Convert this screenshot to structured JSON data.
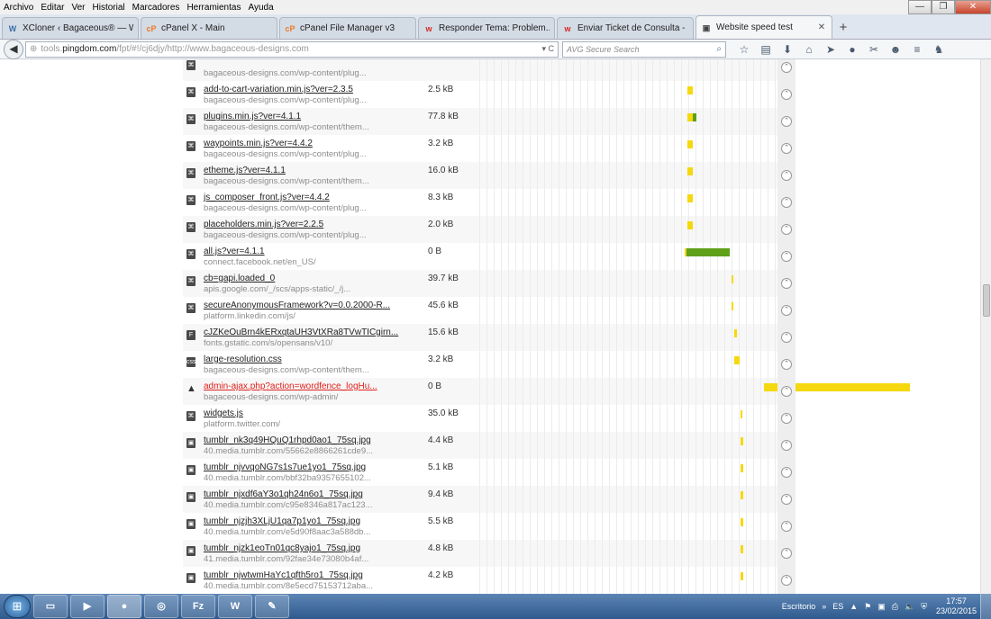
{
  "menubar": {
    "items": [
      {
        "label": "Archivo"
      },
      {
        "label": "Editar"
      },
      {
        "label": "Ver"
      },
      {
        "label": "Historial"
      },
      {
        "label": "Marcadores"
      },
      {
        "label": "Herramientas"
      },
      {
        "label": "Ayuda"
      }
    ]
  },
  "window_controls": {
    "minimize": "—",
    "restore": "❐",
    "close": "✕"
  },
  "tabs": [
    {
      "title": "XCloner ‹ Bagaceous® — Wor...",
      "icon": "wordpress-icon",
      "glyph": "W",
      "color": "#3b6fa8",
      "active": false
    },
    {
      "title": "cPanel X - Main",
      "icon": "cpanel-icon",
      "glyph": "cP",
      "color": "#ef7a2a",
      "active": false
    },
    {
      "title": "cPanel File Manager v3",
      "icon": "cpanel-icon",
      "glyph": "cP",
      "color": "#ef7a2a",
      "active": false
    },
    {
      "title": "Responder Tema: Problem...",
      "icon": "wordfence-icon",
      "glyph": "w",
      "color": "#d7261f",
      "active": false
    },
    {
      "title": "Enviar Ticket de Consulta - ...",
      "icon": "wordfence-icon",
      "glyph": "w",
      "color": "#d7261f",
      "active": false
    },
    {
      "title": "Website speed test",
      "icon": "pingdom-icon",
      "glyph": "▣",
      "color": "#444444",
      "active": true
    }
  ],
  "tab_close_glyph": "✕",
  "new_tab_glyph": "+",
  "navbar": {
    "back_glyph": "◀",
    "url_prefix": "tools.",
    "url_domain": "pingdom.com",
    "url_rest": "/fpt/#!/cj6djy/http://www.bagaceous-designs.com",
    "url_icons": "▾ C",
    "search_placeholder": "AVG Secure Search",
    "search_glyph": "⌕",
    "tool_icons": [
      {
        "name": "bookmark-star-icon",
        "glyph": "☆"
      },
      {
        "name": "reading-list-icon",
        "glyph": "▤"
      },
      {
        "name": "download-icon",
        "glyph": "⬇"
      },
      {
        "name": "home-icon",
        "glyph": "⌂"
      },
      {
        "name": "send-icon",
        "glyph": "➤"
      },
      {
        "name": "addon-icon",
        "glyph": "●"
      },
      {
        "name": "tools-icon",
        "glyph": "✂"
      },
      {
        "name": "chat-icon",
        "glyph": "☻"
      },
      {
        "name": "menu-icon",
        "glyph": "≡"
      },
      {
        "name": "firefox-account-icon",
        "glyph": "♞"
      }
    ]
  },
  "colors": {
    "bar_yellow": "#f5d80f",
    "bar_green": "#5ea018",
    "link_error": "#e0201a"
  },
  "waterfall_rows": [
    {
      "name": "",
      "path": "bagaceous-designs.com/wp-content/plug...",
      "size": "",
      "icon": "script",
      "error": false,
      "bars": [],
      "partial": true
    },
    {
      "name": "add-to-cart-variation.min.js?ver=2.3.5",
      "path": "bagaceous-designs.com/wp-content/plug...",
      "size": "2.5 kB",
      "icon": "script",
      "error": false,
      "bars": [
        {
          "start": 277,
          "width": 6,
          "color": "yellow"
        }
      ]
    },
    {
      "name": "plugins.min.js?ver=4.1.1",
      "path": "bagaceous-designs.com/wp-content/them...",
      "size": "77.8 kB",
      "icon": "script",
      "error": false,
      "bars": [
        {
          "start": 277,
          "width": 6,
          "color": "yellow"
        },
        {
          "start": 283,
          "width": 4,
          "color": "green"
        }
      ]
    },
    {
      "name": "waypoints.min.js?ver=4.4.2",
      "path": "bagaceous-designs.com/wp-content/plug...",
      "size": "3.2 kB",
      "icon": "script",
      "error": false,
      "bars": [
        {
          "start": 277,
          "width": 6,
          "color": "yellow"
        }
      ]
    },
    {
      "name": "etheme.js?ver=4.1.1",
      "path": "bagaceous-designs.com/wp-content/them...",
      "size": "16.0 kB",
      "icon": "script",
      "error": false,
      "bars": [
        {
          "start": 277,
          "width": 6,
          "color": "yellow"
        }
      ]
    },
    {
      "name": "js_composer_front.js?ver=4.4.2",
      "path": "bagaceous-designs.com/wp-content/plug...",
      "size": "8.3 kB",
      "icon": "script",
      "error": false,
      "bars": [
        {
          "start": 277,
          "width": 6,
          "color": "yellow"
        }
      ]
    },
    {
      "name": "placeholders.min.js?ver=2.2.5",
      "path": "bagaceous-designs.com/wp-content/plug...",
      "size": "2.0 kB",
      "icon": "script",
      "error": false,
      "bars": [
        {
          "start": 277,
          "width": 6,
          "color": "yellow"
        }
      ]
    },
    {
      "name": "all.js?ver=4.1.1",
      "path": "connect.facebook.net/en_US/",
      "size": "0 B",
      "icon": "script",
      "error": false,
      "bars": [
        {
          "start": 274,
          "width": 2,
          "color": "yellow"
        },
        {
          "start": 276,
          "width": 48,
          "color": "green"
        }
      ]
    },
    {
      "name": "cb=gapi.loaded_0",
      "path": "apis.google.com/_/scs/apps-static/_/j...",
      "size": "39.7 kB",
      "icon": "script",
      "error": false,
      "bars": [
        {
          "start": 326,
          "width": 2,
          "color": "yellow"
        }
      ]
    },
    {
      "name": "secureAnonymousFramework?v=0.0.2000-R...",
      "path": "platform.linkedin.com/js/",
      "size": "45.6 kB",
      "icon": "script",
      "error": false,
      "bars": [
        {
          "start": 326,
          "width": 2,
          "color": "yellow"
        }
      ]
    },
    {
      "name": "cJZKeOuBrn4kERxqtaUH3VtXRa8TVwTICgirn...",
      "path": "fonts.gstatic.com/s/opensans/v10/",
      "size": "15.6 kB",
      "icon": "font",
      "error": false,
      "bars": [
        {
          "start": 329,
          "width": 3,
          "color": "yellow"
        }
      ]
    },
    {
      "name": "large-resolution.css",
      "path": "bagaceous-designs.com/wp-content/them...",
      "size": "3.2 kB",
      "icon": "css",
      "error": false,
      "bars": [
        {
          "start": 329,
          "width": 6,
          "color": "yellow"
        }
      ]
    },
    {
      "name": "admin-ajax.php?action=wordfence_logHu...",
      "path": "bagaceous-designs.com/wp-admin/",
      "size": "0 B",
      "icon": "warning",
      "error": true,
      "bars": [
        {
          "start": 362,
          "width": 162,
          "color": "yellow"
        }
      ]
    },
    {
      "name": "widgets.js",
      "path": "platform.twitter.com/",
      "size": "35.0 kB",
      "icon": "script",
      "error": false,
      "bars": [
        {
          "start": 336,
          "width": 2,
          "color": "yellow"
        }
      ]
    },
    {
      "name": "tumblr_nk3q49HQuQ1rhpd0ao1_75sq.jpg",
      "path": "40.media.tumblr.com/55662e8866261cde9...",
      "size": "4.4 kB",
      "icon": "image",
      "error": false,
      "bars": [
        {
          "start": 336,
          "width": 3,
          "color": "yellow"
        }
      ]
    },
    {
      "name": "tumblr_njvvqoNG7s1s7ue1yo1_75sq.jpg",
      "path": "40.media.tumblr.com/bbf32ba9357655102...",
      "size": "5.1 kB",
      "icon": "image",
      "error": false,
      "bars": [
        {
          "start": 336,
          "width": 3,
          "color": "yellow"
        }
      ]
    },
    {
      "name": "tumblr_njxdf6aY3o1qh24n6o1_75sq.jpg",
      "path": "40.media.tumblr.com/c95e8346a817ac123...",
      "size": "9.4 kB",
      "icon": "image",
      "error": false,
      "bars": [
        {
          "start": 336,
          "width": 3,
          "color": "yellow"
        }
      ]
    },
    {
      "name": "tumblr_njzjh3XLjU1qa7p1yo1_75sq.jpg",
      "path": "40.media.tumblr.com/e5d90f8aac3a588db...",
      "size": "5.5 kB",
      "icon": "image",
      "error": false,
      "bars": [
        {
          "start": 336,
          "width": 3,
          "color": "yellow"
        }
      ]
    },
    {
      "name": "tumblr_njzk1eoTn01qc8yajo1_75sq.jpg",
      "path": "41.media.tumblr.com/92fae34e73080b4af...",
      "size": "4.8 kB",
      "icon": "image",
      "error": false,
      "bars": [
        {
          "start": 336,
          "width": 3,
          "color": "yellow"
        }
      ]
    },
    {
      "name": "tumblr_njwtwmHaYc1qfth5ro1_75sq.jpg",
      "path": "40.media.tumblr.com/8e5ecd75153712aba...",
      "size": "4.2 kB",
      "icon": "image",
      "error": false,
      "bars": [
        {
          "start": 336,
          "width": 3,
          "color": "yellow"
        }
      ]
    }
  ],
  "expand_glyph": "⌃",
  "taskbar": {
    "start_glyph": "⊞",
    "apps": [
      {
        "name": "explorer-icon",
        "glyph": "▭",
        "active": false
      },
      {
        "name": "media-player-icon",
        "glyph": "▶",
        "active": false
      },
      {
        "name": "firefox-icon",
        "glyph": "●",
        "active": true
      },
      {
        "name": "network-icon",
        "glyph": "◎",
        "active": false
      },
      {
        "name": "filezilla-icon",
        "glyph": "Fz",
        "active": false
      },
      {
        "name": "word-icon",
        "glyph": "W",
        "active": false
      },
      {
        "name": "paint-icon",
        "glyph": "✎",
        "active": false
      }
    ],
    "desktop_label": "Escritorio",
    "tray_chevron": "»",
    "language": "ES",
    "tray_icons": [
      {
        "name": "up-arrow-icon",
        "glyph": "▲"
      },
      {
        "name": "flag-icon",
        "glyph": "⚑"
      },
      {
        "name": "monitor-icon",
        "glyph": "▣"
      },
      {
        "name": "printer-icon",
        "glyph": "⎙"
      },
      {
        "name": "volume-icon",
        "glyph": "🔈"
      },
      {
        "name": "shield-icon",
        "glyph": "⛨"
      }
    ],
    "clock_time": "17:57",
    "clock_date": "23/02/2015"
  }
}
